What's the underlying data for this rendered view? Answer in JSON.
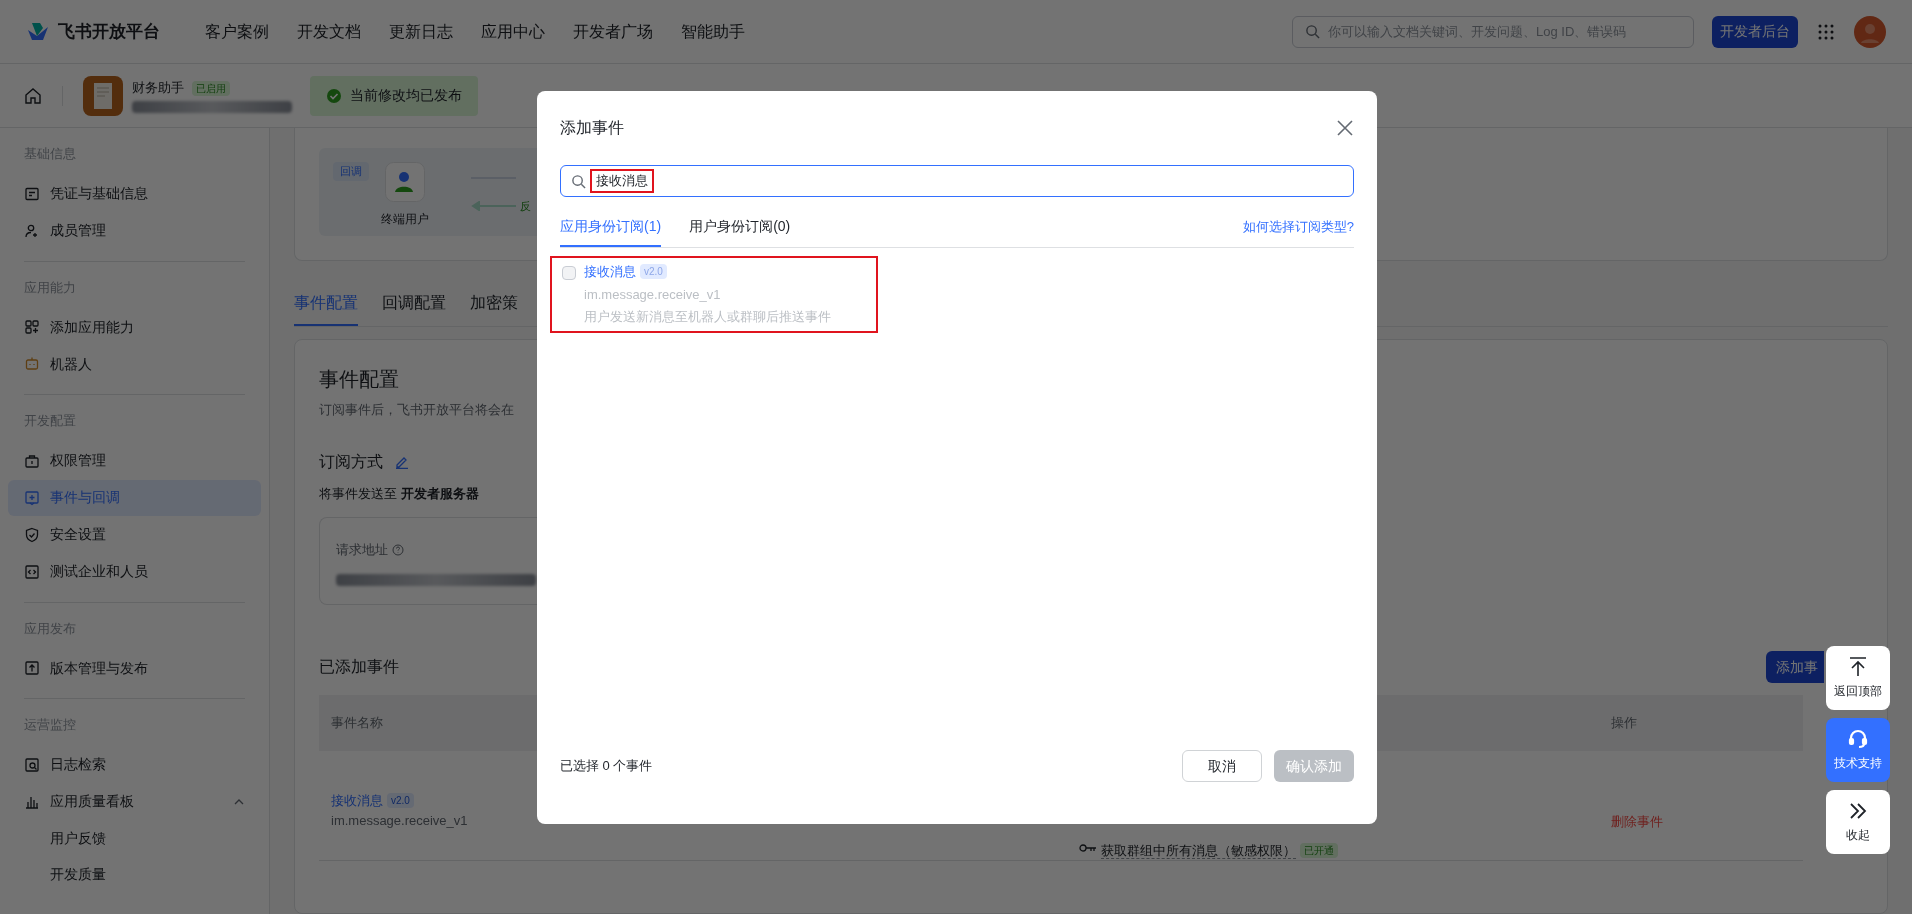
{
  "header": {
    "logo": "飞书开放平台",
    "nav": [
      "客户案例",
      "开发文档",
      "更新日志",
      "应用中心",
      "开发者广场",
      "智能助手"
    ],
    "search": {
      "placeholder": "你可以输入文档关键词、开发问题、Log ID、错误码"
    },
    "console_button": "开发者后台"
  },
  "app_bar": {
    "app_name": "财务助手",
    "app_status": "已启用",
    "publish_status": "当前修改均已发布"
  },
  "sidebar": {
    "sections": [
      {
        "title": "基础信息",
        "items": [
          {
            "label": "凭证与基础信息",
            "selected": false
          },
          {
            "label": "成员管理",
            "selected": false
          }
        ]
      },
      {
        "title": "应用能力",
        "items": [
          {
            "label": "添加应用能力",
            "selected": false
          },
          {
            "label": "机器人",
            "selected": false
          }
        ]
      },
      {
        "title": "开发配置",
        "items": [
          {
            "label": "权限管理",
            "selected": false
          },
          {
            "label": "事件与回调",
            "selected": true
          },
          {
            "label": "安全设置",
            "selected": false
          },
          {
            "label": "测试企业和人员",
            "selected": false
          }
        ]
      },
      {
        "title": "应用发布",
        "items": [
          {
            "label": "版本管理与发布",
            "selected": false
          }
        ]
      },
      {
        "title": "运营监控",
        "items": [
          {
            "label": "日志检索",
            "selected": false
          },
          {
            "label": "应用质量看板",
            "selected": false,
            "expanded": true,
            "children": [
              {
                "label": "用户反馈"
              },
              {
                "label": "开发质量"
              }
            ]
          }
        ]
      }
    ]
  },
  "diagram": {
    "tag": "回调",
    "user": "终端用户",
    "arrow_label": "反"
  },
  "main_tabs": [
    {
      "label": "事件配置",
      "selected": true
    },
    {
      "label": "回调配置",
      "selected": false
    },
    {
      "label": "加密策",
      "selected": false
    }
  ],
  "event_config": {
    "title": "事件配置",
    "description": "订阅事件后，飞书开放平台将会在",
    "subscribe_title": "订阅方式",
    "send_to": "将事件发送至 **开发者服务器**",
    "url_label": "请求地址"
  },
  "added_events": {
    "title": "已添加事件",
    "add_button": "添加事",
    "columns": [
      "事件名称",
      "操作"
    ],
    "rows": [
      {
        "name": "接收消息",
        "version": "v2.0",
        "key": "im.message.receive_v1",
        "permission": "获取群组中所有消息（敏感权限）",
        "permission_status": "已开通",
        "action": "删除事件"
      }
    ]
  },
  "float_buttons": [
    {
      "label": "返回顶部",
      "selected": false
    },
    {
      "label": "技术支持",
      "selected": true
    },
    {
      "label": "收起",
      "selected": false
    }
  ],
  "dialog": {
    "title": "添加事件",
    "search_value": "接收消息",
    "tabs": [
      {
        "label": "应用身份订阅(1)",
        "selected": true
      },
      {
        "label": "用户身份订阅(0)",
        "selected": false
      }
    ],
    "help_link": "如何选择订阅类型?",
    "events": [
      {
        "name": "接收消息",
        "version": "v2.0",
        "key": "im.message.receive_v1",
        "description": "用户发送新消息至机器人或群聊后推送事件",
        "checked": false
      }
    ],
    "selected_count": "已选择 0 个事件",
    "cancel": "取消",
    "confirm": "确认添加",
    "confirm_disabled": true
  }
}
